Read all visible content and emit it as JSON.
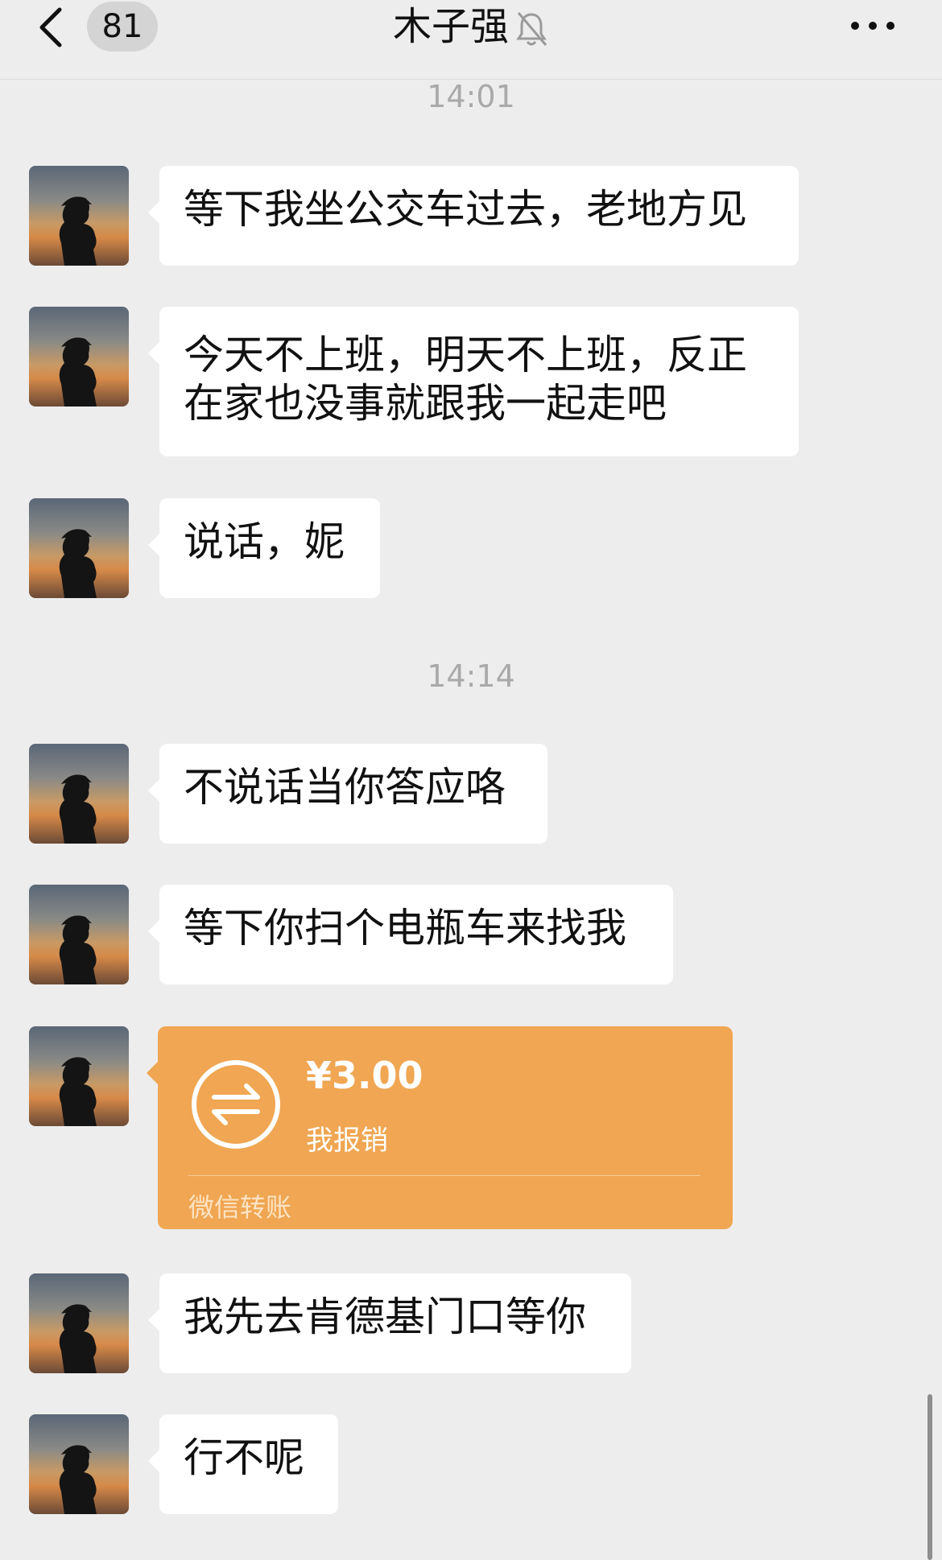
{
  "header": {
    "unread_count": "81",
    "title": "木子强",
    "back_icon": "chevron-left-icon",
    "mute_icon": "bell-off-icon",
    "more_icon": "ellipsis-icon"
  },
  "timestamps": [
    "14:01",
    "14:14"
  ],
  "messages": [
    {
      "text": "等下我坐公交车过去，老地方见"
    },
    {
      "text": "今天不上班，明天不上班，反正在家也没事就跟我一起走吧"
    },
    {
      "text": "说话，妮"
    },
    {
      "text": "不说话当你答应咯"
    },
    {
      "text": "等下你扫个电瓶车来找我"
    },
    {
      "text": "我先去肯德基门口等你"
    },
    {
      "text": "行不呢"
    }
  ],
  "transfer": {
    "amount": "¥3.00",
    "note": "我报销",
    "label": "微信转账",
    "icon": "transfer-arrows-icon",
    "color": "#f0a652"
  },
  "colors": {
    "background": "#ededed",
    "bubble": "#ffffff",
    "timestamp": "#a9a9a9"
  }
}
